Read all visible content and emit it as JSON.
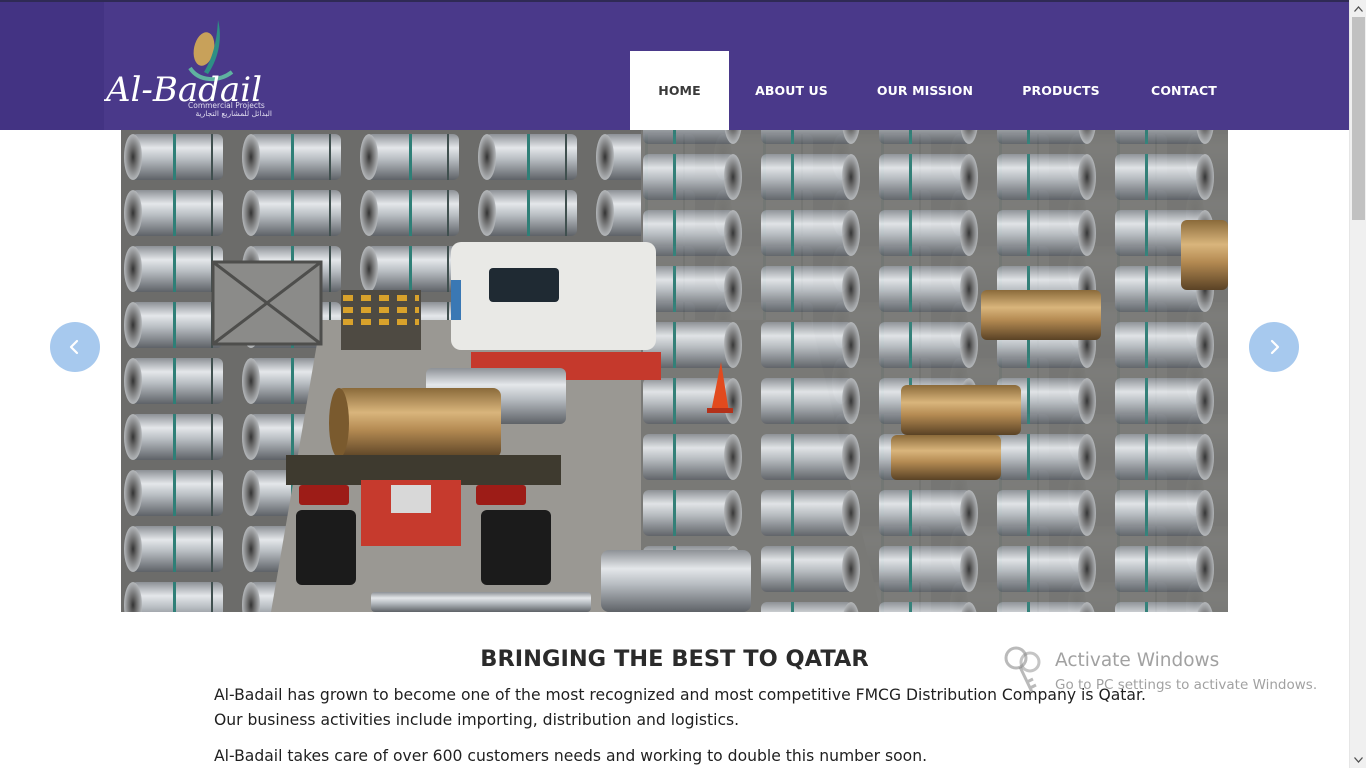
{
  "brand": {
    "name": "Al-Badail",
    "tagline": "Commercial Projects",
    "arabic": "البدائل للمشاريع التجارية"
  },
  "nav": {
    "items": [
      {
        "label": "HOME",
        "active": true
      },
      {
        "label": "ABOUT US",
        "active": false
      },
      {
        "label": "OUR MISSION",
        "active": false
      },
      {
        "label": "PRODUCTS",
        "active": false
      },
      {
        "label": "CONTACT",
        "active": false
      }
    ]
  },
  "slider": {
    "image_description": "warehouse with steel coils and truck",
    "prev_icon": "chevron-left-icon",
    "next_icon": "chevron-right-icon"
  },
  "content": {
    "headline": "BRINGING THE BEST TO QATAR",
    "paragraph1": "Al-Badail has grown to become one of the most recognized and most competitive FMCG Distribution Company is Qatar. Our business activities include importing, distribution and logistics.",
    "paragraph2": "Al-Badail takes care of over 600 customers needs and working to double this number soon."
  },
  "watermark": {
    "title": "Activate Windows",
    "subtitle": "Go to PC settings to activate Windows."
  },
  "colors": {
    "header": "#4a398a",
    "arrow": "#a7c9ee",
    "nav_active_bg": "#ffffff"
  }
}
